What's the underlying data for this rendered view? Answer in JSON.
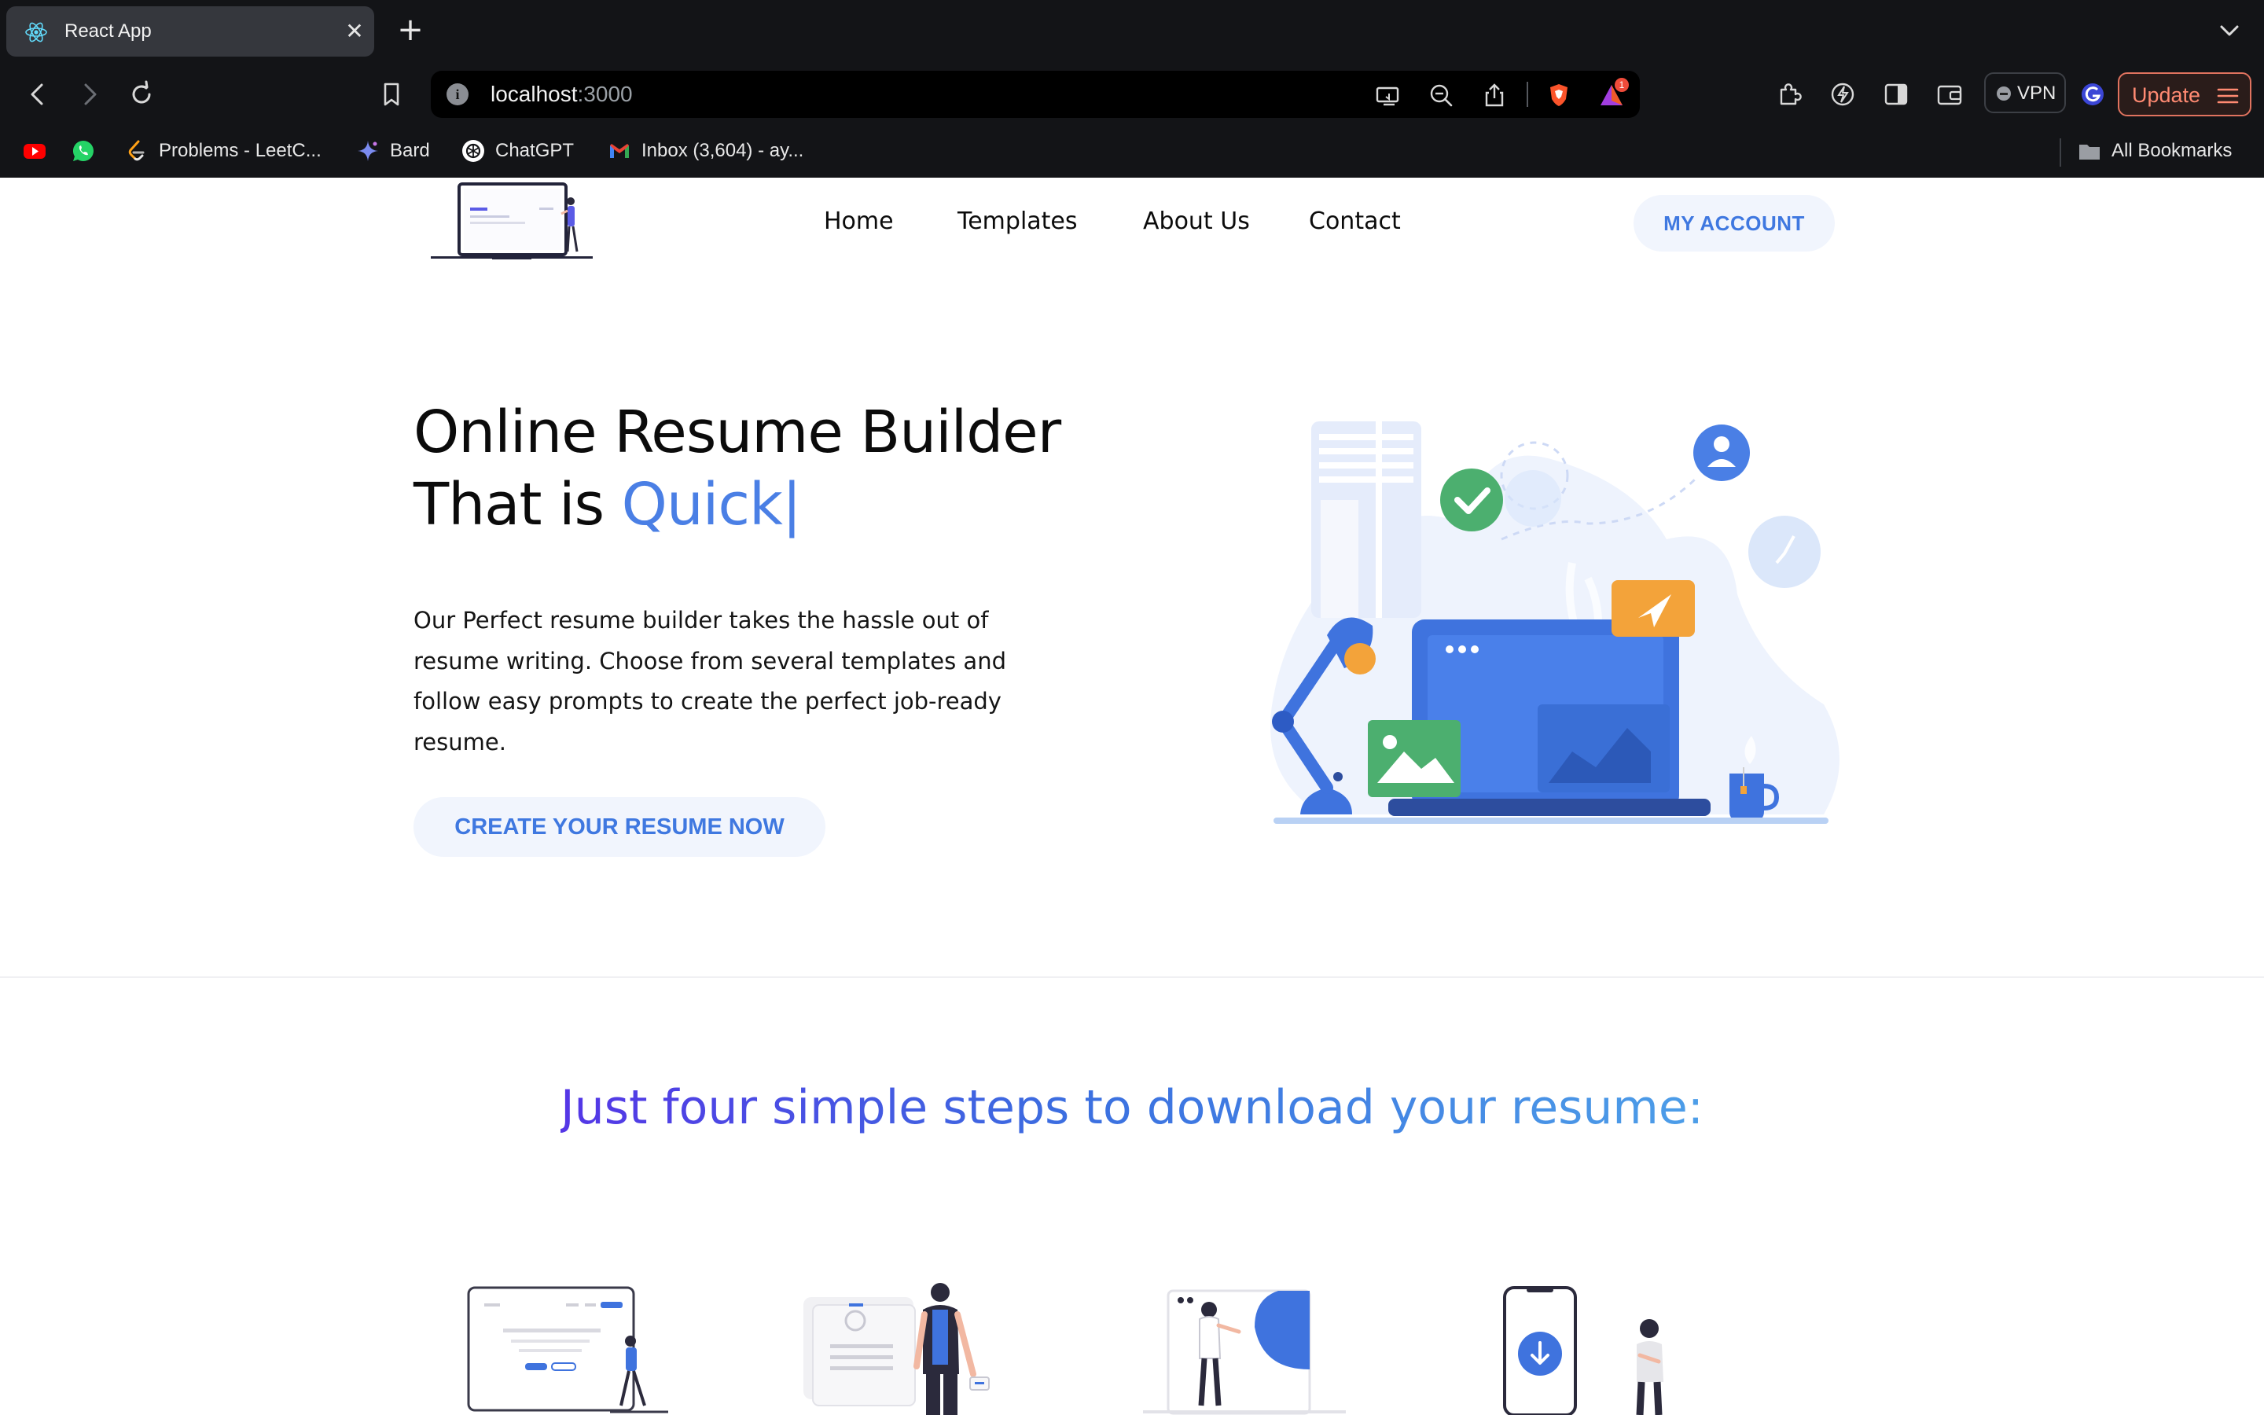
{
  "browser": {
    "tab": {
      "title": "React App",
      "favicon": "react-atom-icon"
    },
    "address_bar": {
      "host": "localhost",
      "port": ":3000"
    },
    "brave_rewards_badge": "1",
    "vpn_label": "VPN",
    "update_label": "Update",
    "bookmarks": [
      {
        "label": "",
        "icon": "youtube-icon"
      },
      {
        "label": "",
        "icon": "whatsapp-icon"
      },
      {
        "label": "Problems - LeetC...",
        "icon": "leetcode-icon"
      },
      {
        "label": "Bard",
        "icon": "bard-sparkle-icon"
      },
      {
        "label": "ChatGPT",
        "icon": "chatgpt-icon"
      },
      {
        "label": "Inbox (3,604) - ay...",
        "icon": "gmail-icon"
      }
    ],
    "all_bookmarks_label": "All Bookmarks"
  },
  "site": {
    "nav": {
      "links": [
        "Home",
        "Templates",
        "About Us",
        "Contact"
      ],
      "account_button": "MY ACCOUNT"
    },
    "hero": {
      "title_line1": "Online Resume Builder",
      "title_line2_prefix": "That is ",
      "title_line2_accent": "Quick",
      "cursor": "|",
      "description": "Our Perfect resume builder takes the hassle out of resume writing. Choose from several templates and follow easy prompts to create the perfect job-ready resume.",
      "cta": "CREATE YOUR RESUME NOW"
    },
    "steps": {
      "title": "Just four simple steps to download your resume:"
    }
  },
  "colors": {
    "brand_blue": "#4a7fe5",
    "button_bg": "#f1f5fd",
    "chrome_bg": "#131417",
    "update_accent": "#e0735f"
  }
}
